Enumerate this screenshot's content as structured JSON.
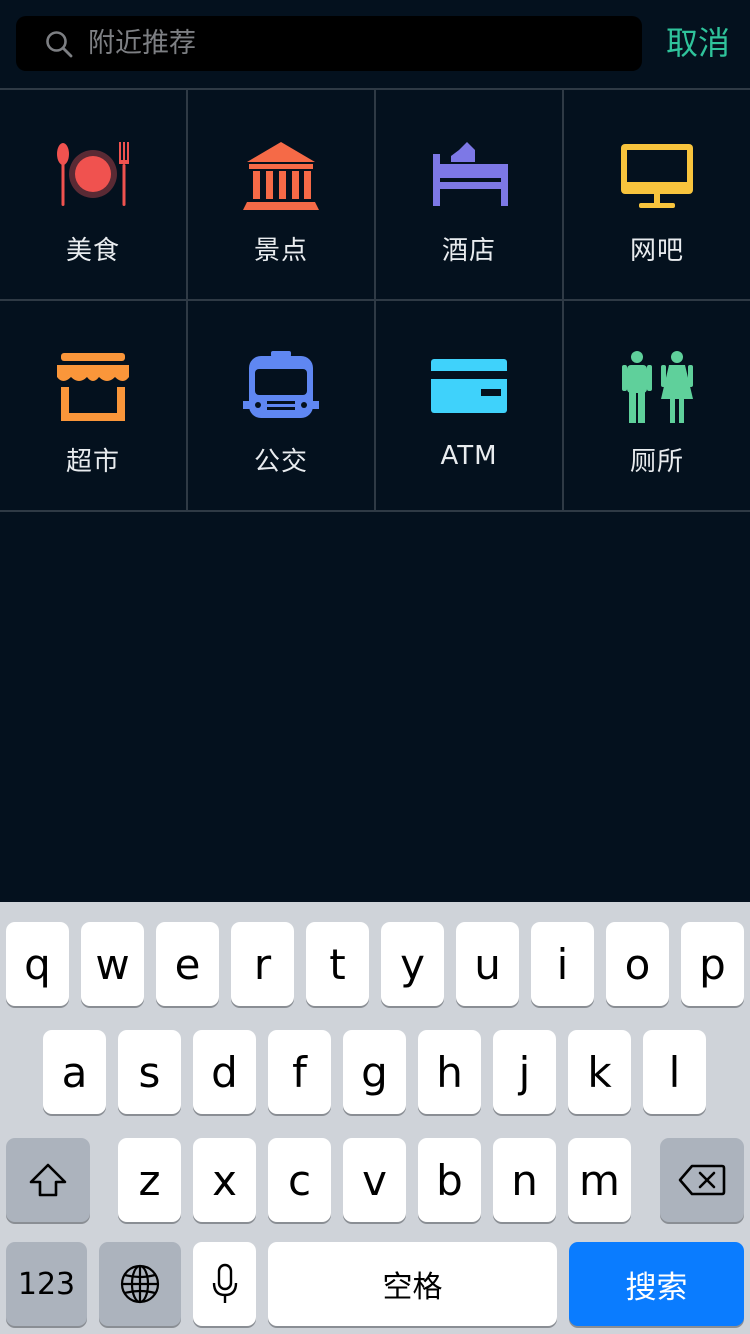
{
  "search": {
    "placeholder": "附近推荐",
    "value": "",
    "cancel_label": "取消"
  },
  "categories": [
    {
      "label": "美食",
      "icon": "restaurant-icon",
      "color": "#f0524f"
    },
    {
      "label": "景点",
      "icon": "landmark-icon",
      "color": "#f56a47"
    },
    {
      "label": "酒店",
      "icon": "hotel-bed-icon",
      "color": "#7d78e6"
    },
    {
      "label": "网吧",
      "icon": "monitor-icon",
      "color": "#f8c43d"
    },
    {
      "label": "超市",
      "icon": "store-icon",
      "color": "#fa963a"
    },
    {
      "label": "公交",
      "icon": "bus-icon",
      "color": "#5f87f2"
    },
    {
      "label": "ATM",
      "icon": "credit-card-icon",
      "color": "#3fd2fb"
    },
    {
      "label": "厕所",
      "icon": "restroom-icon",
      "color": "#5fd09b"
    }
  ],
  "keyboard": {
    "row1": [
      "q",
      "w",
      "e",
      "r",
      "t",
      "y",
      "u",
      "i",
      "o",
      "p"
    ],
    "row2": [
      "a",
      "s",
      "d",
      "f",
      "g",
      "h",
      "j",
      "k",
      "l"
    ],
    "row3": [
      "z",
      "x",
      "c",
      "v",
      "b",
      "n",
      "m"
    ],
    "numbers_label": "123",
    "space_label": "空格",
    "search_label": "搜索",
    "accent_color": "#0a7cff"
  }
}
